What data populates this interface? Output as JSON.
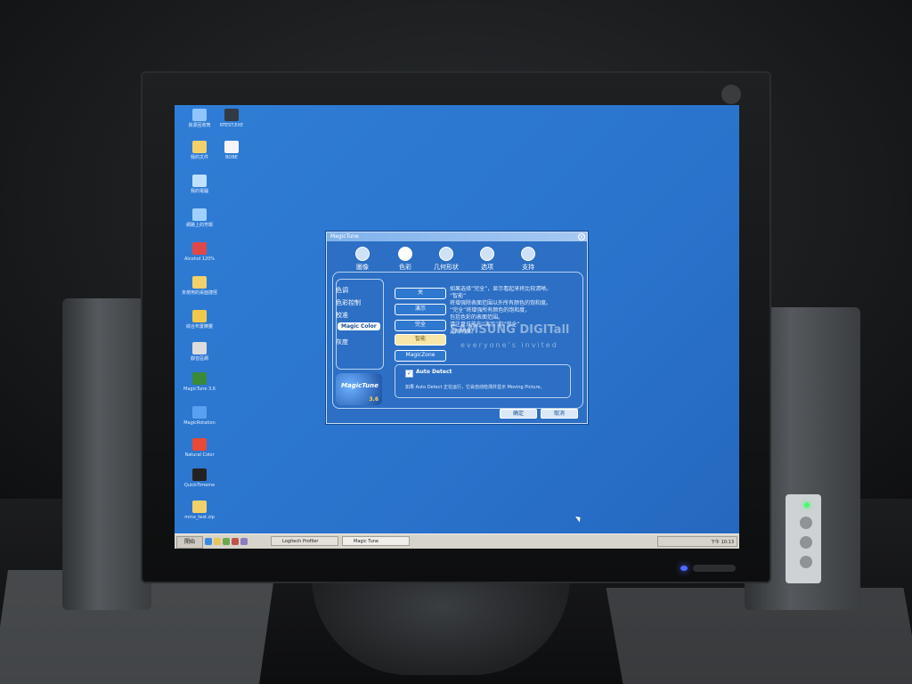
{
  "desktop": {
    "icons": [
      {
        "label": "資源回收筒",
        "icon": "recycle-bin-icon",
        "color": "#8fc4ff"
      },
      {
        "label": "RTEST.EXE",
        "icon": "program-icon",
        "color": "#333a44"
      },
      {
        "label": "我的文件",
        "icon": "documents-folder-icon",
        "color": "#f2d16b"
      },
      {
        "label": "BOBE",
        "icon": "text-file-icon",
        "color": "#f5f5f5"
      },
      {
        "label": "我的電腦",
        "icon": "computer-icon",
        "color": "#bfe0ff"
      },
      {
        "label": "網路上的芳鄰",
        "icon": "network-icon",
        "color": "#9fd0ff"
      },
      {
        "label": "Alcohol 120%",
        "icon": "alcohol-disc-icon",
        "color": "#e04848"
      },
      {
        "label": "未使用的桌面捷徑",
        "icon": "folder-icon",
        "color": "#f2d16b"
      },
      {
        "label": "綜合布置精靈",
        "icon": "wizard-icon",
        "color": "#f0c94a"
      },
      {
        "label": "靜音區網",
        "icon": "sound-icon",
        "color": "#dcdcdc"
      },
      {
        "label": "MagicTune 3.6",
        "icon": "magictune-icon",
        "color": "#3a8a3a"
      },
      {
        "label": "MagicRotation",
        "icon": "rotation-icon",
        "color": "#5aa0f0"
      },
      {
        "label": "Natural Color",
        "icon": "natural-color-icon",
        "color": "#e84a3a"
      },
      {
        "label": "QuickTimeme",
        "icon": "quicktime-icon",
        "color": "#222222"
      },
      {
        "label": "mmx_test.zip",
        "icon": "zip-archive-icon",
        "color": "#f2d16b"
      }
    ]
  },
  "taskbar": {
    "start_label": "開始",
    "tasks": [
      {
        "label": "Logitech Profiler",
        "active": false
      },
      {
        "label": "Magic Tune",
        "active": true
      }
    ],
    "clock": "下午 10:13"
  },
  "magictune": {
    "title": "MagicTune",
    "close_label": "×",
    "tabs": [
      {
        "label": "圖像",
        "icon": "monitor-image-icon",
        "selected": false
      },
      {
        "label": "色彩",
        "icon": "color-palette-icon",
        "selected": true
      },
      {
        "label": "几何形状",
        "icon": "geometry-icon",
        "selected": false
      },
      {
        "label": "选项",
        "icon": "options-icon",
        "selected": false
      },
      {
        "label": "支持",
        "icon": "support-icon",
        "selected": false
      }
    ],
    "side_menu": [
      {
        "label": "色调",
        "selected": false
      },
      {
        "label": "色彩控制",
        "selected": false
      },
      {
        "label": "校准",
        "selected": false
      },
      {
        "label": "Magic Color",
        "selected": true
      },
      {
        "label": "灰度",
        "selected": false
      }
    ],
    "options": [
      {
        "label": "关",
        "selected": false
      },
      {
        "label": "演示",
        "selected": false
      },
      {
        "label": "完全",
        "selected": false
      },
      {
        "label": "智能",
        "selected": true
      },
      {
        "label": "MagicZone",
        "selected": false
      }
    ],
    "description_lines": [
      "如果选择“完全”，显示看起来将比较清晰。",
      "“智能”",
      "将增强除表面范围以外所有颜色的饱和度。",
      "“完全”将增强所有颜色的饱和度，",
      "包括色彩的表面范围。",
      "请注意只能在“演示”和“完全”",
      "之间切换。"
    ],
    "watermark_line1": "SAMSUNG DIGITall",
    "watermark_line2": "everyone's invited",
    "logo_text": "MagicTune",
    "logo_version": "3.6",
    "auto_detect": {
      "checked": true,
      "label": "Auto Detect",
      "description": "如果 Auto Detect 正在运行，它会自动检测并显示 Moving Picture。"
    },
    "ok_label": "确定",
    "cancel_label": "取消"
  }
}
